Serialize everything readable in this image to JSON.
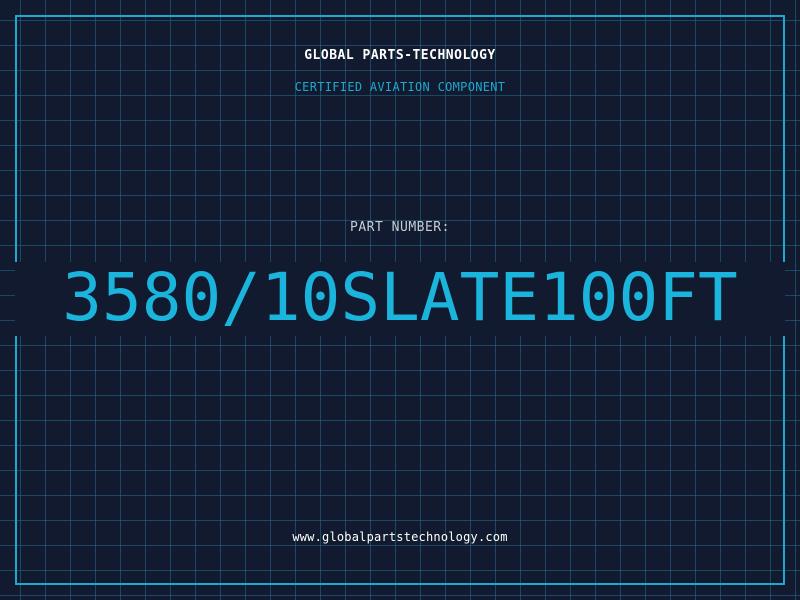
{
  "header": {
    "company": "GLOBAL PARTS-TECHNOLOGY",
    "tagline": "CERTIFIED AVIATION COMPONENT"
  },
  "part": {
    "label": "PART NUMBER:",
    "number": "3580/10SLATE100FT"
  },
  "footer": {
    "website": "www.globalpartstechnology.com"
  },
  "colors": {
    "background": "#111a2e",
    "accent": "#1ab4dd",
    "grid": "#1e5a78",
    "frame": "#1fa8cf"
  }
}
